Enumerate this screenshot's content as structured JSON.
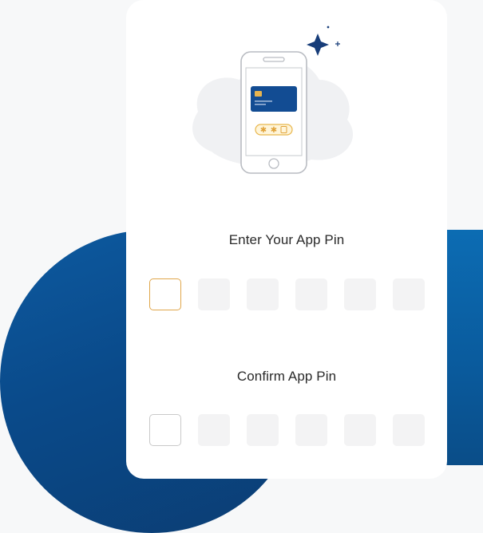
{
  "colors": {
    "accent_blue": "#0a4a8a",
    "active_border": "#e0a64a",
    "box_fill": "#f3f3f4"
  },
  "enter_section": {
    "title": "Enter Your App Pin",
    "digits": 6,
    "active_index": 0
  },
  "confirm_section": {
    "title": "Confirm App Pin",
    "digits": 6
  },
  "illustration": {
    "icon": "phone-card-pin-icon",
    "sparkle_icon": "sparkle-icon"
  }
}
